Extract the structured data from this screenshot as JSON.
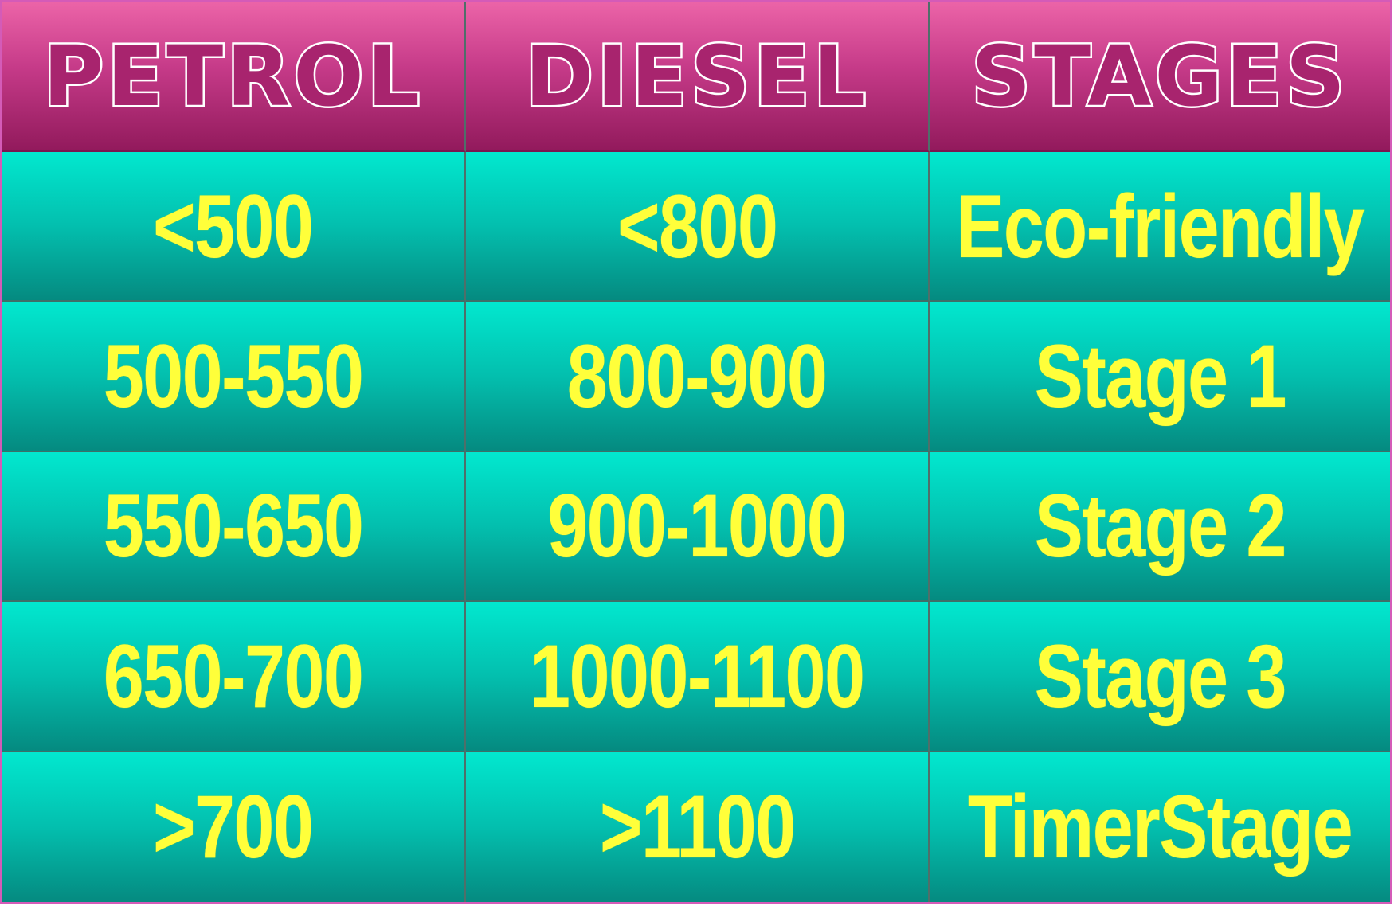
{
  "table": {
    "headers": [
      "PETROL",
      "DIESEL",
      "STAGES"
    ],
    "rows": [
      [
        "<500",
        "<800",
        "Eco-friendly"
      ],
      [
        "500-550",
        "800-900",
        "Stage 1"
      ],
      [
        "550-650",
        "900-1000",
        "Stage 2"
      ],
      [
        "650-700",
        "1000-1100",
        "Stage 3"
      ],
      [
        ">700",
        ">1100",
        "TimerStage"
      ]
    ]
  },
  "colors": {
    "header_top": "#ec64a8",
    "header_bottom": "#921a5c",
    "cell_top": "#02e8cf",
    "cell_bottom": "#058a80",
    "cell_text": "#ffff3a",
    "header_text_outline": "#ffffff"
  }
}
